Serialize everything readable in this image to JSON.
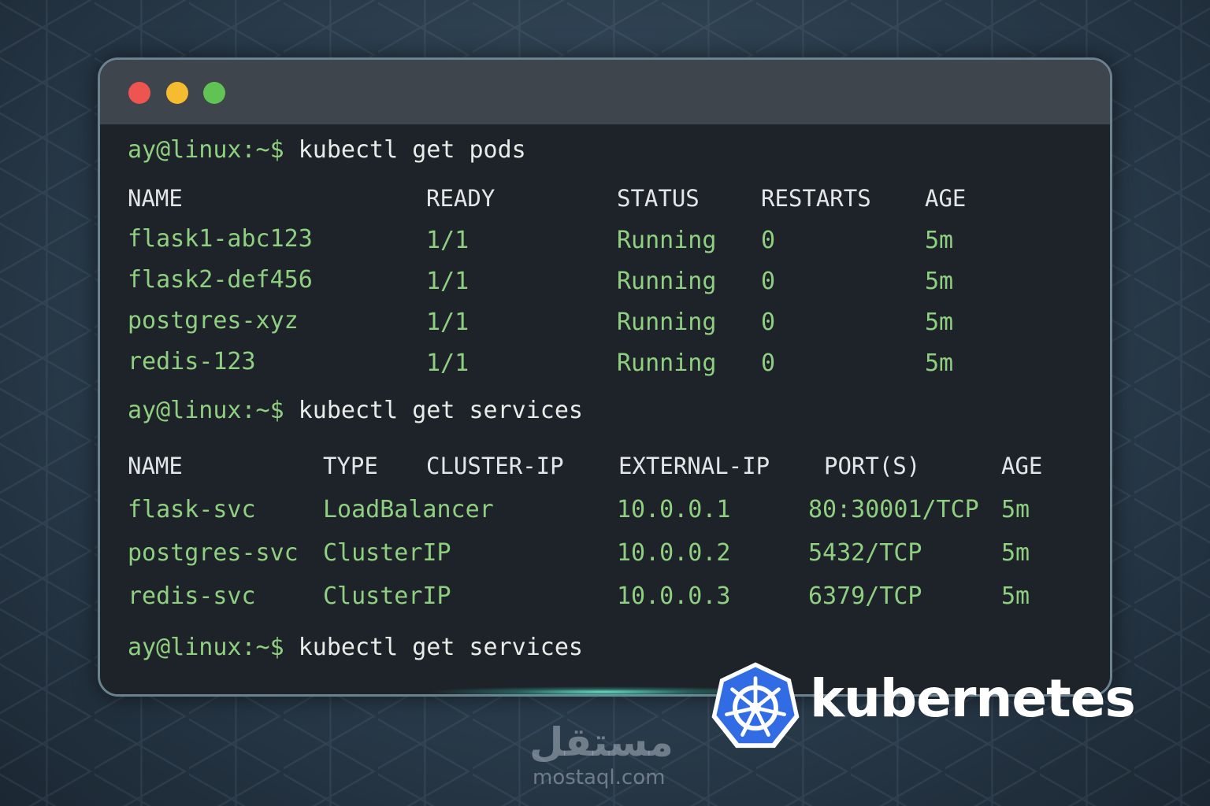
{
  "window": {
    "controls": [
      "close",
      "minimize",
      "maximize"
    ]
  },
  "prompt": "ay@linux:~$",
  "commands": [
    "kubectl get pods",
    "kubectl get services",
    "kubectl get services"
  ],
  "pods": {
    "headers": [
      "NAME",
      "READY",
      "STATUS",
      "RESTARTS",
      "AGE"
    ],
    "rows": [
      [
        "flask1-abc123",
        "1/1",
        "Running",
        "0",
        "5m"
      ],
      [
        "flask2-def456",
        "1/1",
        "Running",
        "0",
        "5m"
      ],
      [
        "postgres-xyz",
        "1/1",
        "Running",
        "0",
        "5m"
      ],
      [
        "redis-123",
        "1/1",
        "Running",
        "0",
        "5m"
      ]
    ]
  },
  "services": {
    "headers": [
      "NAME",
      "TYPE",
      "CLUSTER-IP",
      "EXTERNAL-IP",
      "PORT(S)",
      "AGE"
    ],
    "rows": [
      [
        "flask-svc",
        "LoadBalancer",
        "10.0.0.1",
        "80:30001/TCP",
        "5m"
      ],
      [
        "postgres-svc",
        "ClusterIP",
        "10.0.0.2",
        "5432/TCP",
        "5m"
      ],
      [
        "redis-svc",
        "ClusterIP",
        "10.0.0.3",
        "6379/TCP",
        "5m"
      ]
    ]
  },
  "brand": {
    "name": "kubernetes",
    "logo_icon": "kubernetes-helm-wheel-icon",
    "logo_color": "#326ce5"
  },
  "watermark": {
    "arabic": "مستقل",
    "url": "mostaql.com"
  },
  "colors": {
    "prompt_green": "#8fd080",
    "terminal_bg": "#1e2329",
    "titlebar_bg": "#3e454d"
  }
}
